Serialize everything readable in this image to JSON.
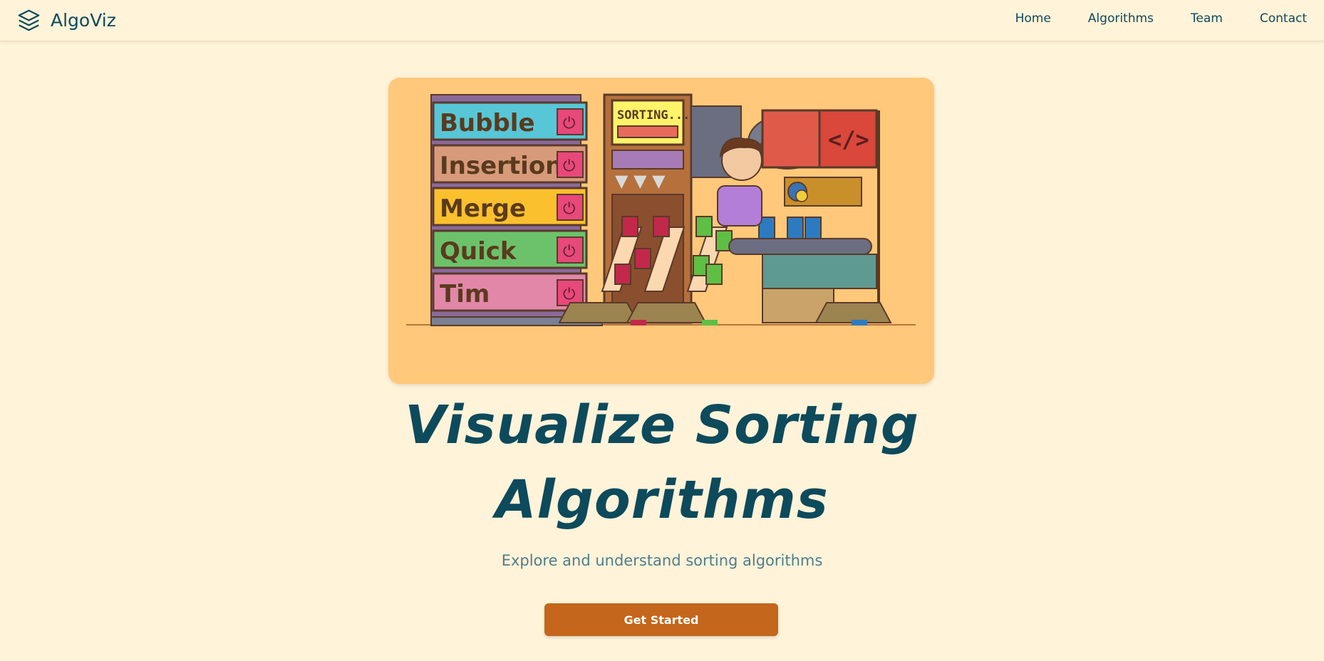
{
  "brand": {
    "name": "AlgoViz",
    "icon": "layers-icon"
  },
  "nav": {
    "items": [
      "Home",
      "Algorithms",
      "Team",
      "Contact"
    ]
  },
  "illustration": {
    "algorithm_labels": [
      "Bubble",
      "Insertion",
      "Merge",
      "Quick",
      "Tim"
    ],
    "display_text": "SORTING...",
    "code_symbol": "</>"
  },
  "hero": {
    "title_line1": "Visualize Sorting",
    "title_line2": "Algorithms",
    "subtitle": "Explore and understand sorting algorithms",
    "cta_label": "Get Started"
  },
  "colors": {
    "background": "#fff3d9",
    "primary_text": "#0d4a5c",
    "accent_button": "#c4661b",
    "hero_card": "#ffc87a"
  }
}
